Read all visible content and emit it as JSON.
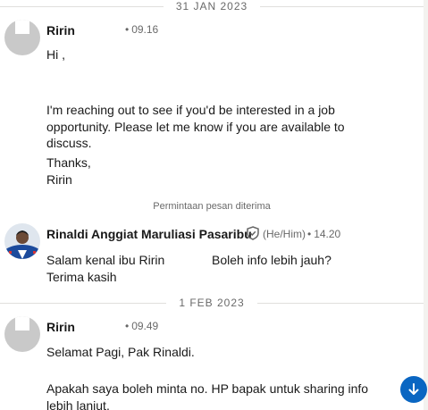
{
  "conversation": {
    "date_separators": [
      {
        "label": "31 JAN 2023"
      },
      {
        "label": "1 FEB 2023"
      }
    ],
    "messages": [
      {
        "sender": "Ririn",
        "time": "09.16",
        "lines": [
          "Hi ,",
          "",
          "I'm reaching out to see if you'd be interested in a job",
          "opportunity. Please let me know if you are available to",
          "discuss.",
          "",
          "Thanks,",
          "Ririn"
        ]
      },
      {
        "system_note": "Permintaan pesan diterima"
      },
      {
        "sender": "Rinaldi Anggiat Maruliasi Pasaribu",
        "pronouns": "(He/Him)",
        "time": "14.20",
        "lines": [
          "Salam kenal ibu Ririn",
          "Boleh info lebih jauh?",
          "Terima kasih"
        ]
      },
      {
        "sender": "Ririn",
        "time": "09.49",
        "lines": [
          "Selamat Pagi, Pak Rinaldi.",
          "",
          "Apakah saya boleh minta no. HP bapak untuk sharing info",
          "lebih lanjut."
        ]
      }
    ]
  },
  "colors": {
    "accent": "#0a66c2",
    "verified_badge": "#666666"
  },
  "icons": {
    "verified": "shield-check-icon",
    "scroll_down": "arrow-down-icon"
  }
}
